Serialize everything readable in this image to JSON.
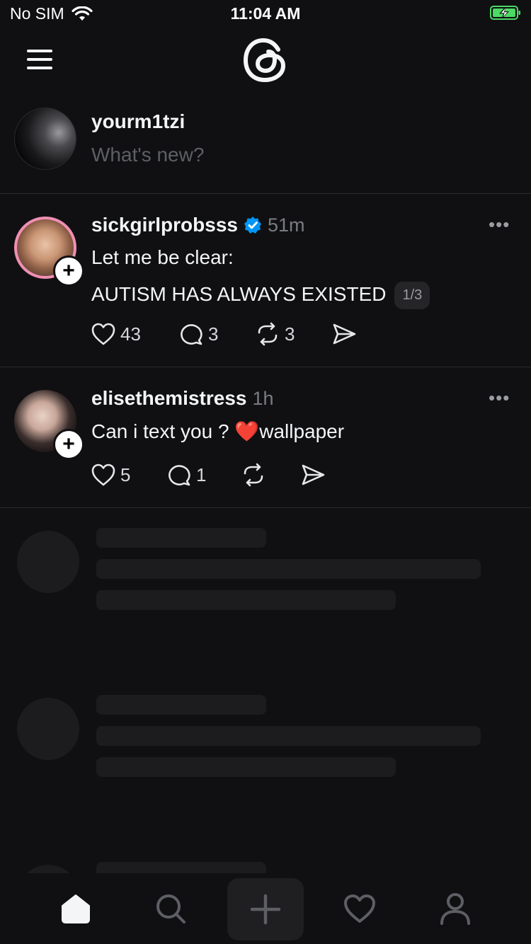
{
  "status_bar": {
    "carrier": "No SIM",
    "time": "11:04 AM"
  },
  "composer": {
    "username": "yourm1tzi",
    "placeholder": "What's new?"
  },
  "posts": [
    {
      "username": "sickgirlprobsss",
      "verified": true,
      "time": "51m",
      "lines": [
        "Let me be clear:",
        "AUTISM HAS ALWAYS EXISTED"
      ],
      "page_indicator": "1/3",
      "likes": "43",
      "replies": "3",
      "reposts": "3"
    },
    {
      "username": "elisethemistress",
      "verified": false,
      "time": "1h",
      "text_before_emoji": "Can i text you ?",
      "emoji": "❤️",
      "text_after_emoji": "wallpaper",
      "likes": "5",
      "replies": "1",
      "reposts": ""
    }
  ],
  "colors": {
    "background": "#101012",
    "text": "#f3f5f7",
    "muted": "#7a7c80",
    "verified": "#0095f6",
    "battery": "#4cd964",
    "avatar_ring": "#f08fb3"
  },
  "icons": {
    "menu": "menu-icon",
    "logo": "threads-logo-icon",
    "tabs": [
      "home-icon",
      "search-icon",
      "plus-icon",
      "heart-icon",
      "profile-icon"
    ]
  }
}
